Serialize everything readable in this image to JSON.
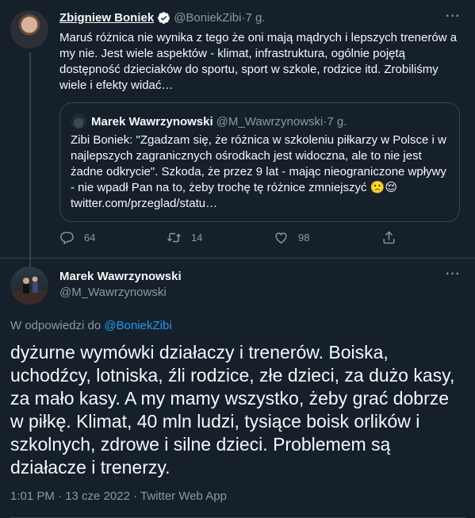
{
  "tweet1": {
    "author_name": "Zbigniew Boniek",
    "author_handle": "@BoniekZibi",
    "sep": " · ",
    "time": "7 g.",
    "text": "Maruś różnica nie wynika z tego że oni mają mądrych i lepszych trenerów a my nie. Jest wiele aspektów - klimat, infrastruktura, ogólnie pojętą dostępność dzieciaków do sportu, sport w szkole, rodzice itd. Zrobiliśmy wiele i efekty widać…",
    "quote": {
      "author_name": "Marek Wawrzynowski",
      "author_handle": "@M_Wawrzynowski",
      "sep": " · ",
      "time": "7 g.",
      "text": "Zibi Boniek: \"Zgadzam się, że różnica w szkoleniu piłkarzy w Polsce i w najlepszych zagranicznych ośrodkach jest widoczna, ale to nie jest żadne odkrycie\". Szkoda, że przez 9 lat - mając nieograniczone wpływy - nie wpadł Pan na to, żeby trochę tę różnice zmniejszyć 🙁😌 twitter.com/przeglad/statu…"
    },
    "replies": "64",
    "retweets": "14",
    "likes": "98"
  },
  "tweet2": {
    "author_name": "Marek Wawrzynowski",
    "author_handle": "@M_Wawrzynowski",
    "reply_prefix": "W odpowiedzi do ",
    "reply_to": "@BoniekZibi",
    "text": "dyżurne wymówki działaczy i trenerów. Boiska, uchodźcy, lotniska, źli rodzice, złe dzieci, za dużo kasy, za mało kasy. A my mamy wszystko, żeby grać dobrze w piłkę. Klimat, 40 mln ludzi, tysiące boisk orlików i szkolnych, zdrowe i silne dzieci. Problemem są działacze i trenerzy.",
    "meta": "1:01 PM · 13 cze 2022 · Twitter Web App"
  },
  "icons": {
    "more": "more-icon",
    "reply": "reply-icon",
    "retweet": "retweet-icon",
    "like": "like-icon",
    "share": "share-icon",
    "verified": "verified-icon"
  },
  "colors": {
    "background": "#15202b",
    "accent": "#1d9bf0",
    "muted": "#8b98a5",
    "border": "#38444d"
  }
}
